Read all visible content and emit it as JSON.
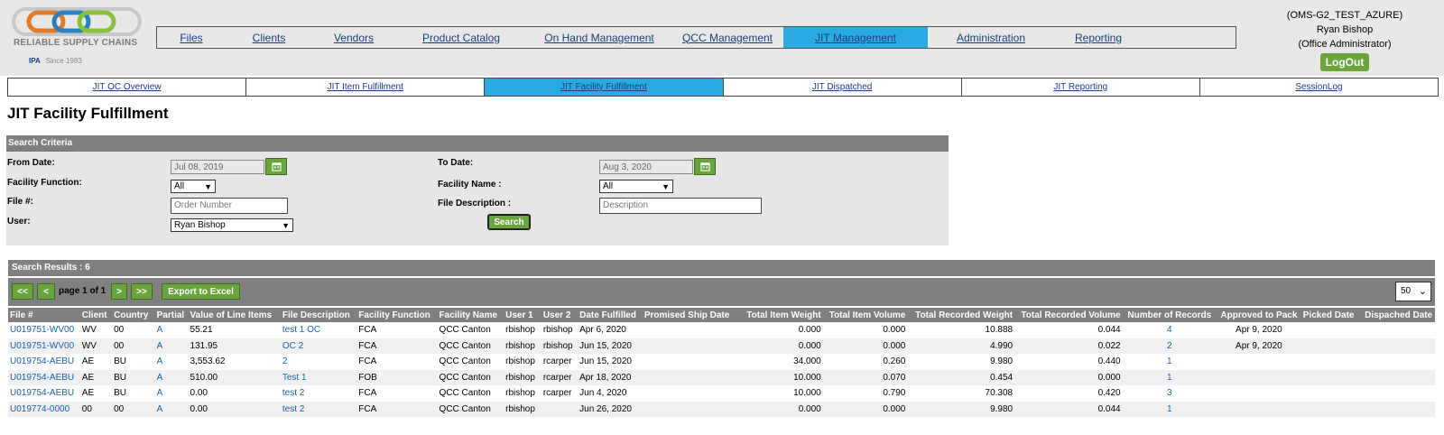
{
  "logo": {
    "brand": "RELIABLE SUPPLY CHAINS",
    "powered_by": "IPA",
    "since": "Since 1983",
    "ring_colors": [
      "#e07b2a",
      "#2a7fc1",
      "#8cbf3f",
      "#c0c0c0"
    ]
  },
  "main_nav": [
    {
      "label": "Files",
      "active": false
    },
    {
      "label": "Clients",
      "active": false
    },
    {
      "label": "Vendors",
      "active": false
    },
    {
      "label": "Product Catalog",
      "active": false
    },
    {
      "label": "On Hand Management",
      "active": false
    },
    {
      "label": "QCC Management",
      "active": false
    },
    {
      "label": "JIT Management",
      "active": true
    },
    {
      "label": "Administration",
      "active": false
    },
    {
      "label": "Reporting",
      "active": false
    }
  ],
  "user": {
    "environment": "(OMS-G2_TEST_AZURE)",
    "name": "Ryan Bishop",
    "role": "(Office Administrator)",
    "logout_label": "LogOut"
  },
  "sub_nav": [
    {
      "label": "JIT OC Overview",
      "active": false
    },
    {
      "label": "JIT Item Fulfillment",
      "active": false
    },
    {
      "label": "JIT Facility Fulfillment",
      "active": true
    },
    {
      "label": "JIT Dispatched",
      "active": false
    },
    {
      "label": "JIT Reporting",
      "active": false
    },
    {
      "label": "SessionLog",
      "active": false
    }
  ],
  "page_title": "JIT Facility Fulfillment",
  "search": {
    "header": "Search Criteria",
    "from_date_label": "From Date:",
    "from_date_value": "Jul 08, 2019",
    "to_date_label": "To Date:",
    "to_date_value": "Aug 3, 2020",
    "facility_function_label": "Facility Function:",
    "facility_function_value": "All",
    "facility_name_label": "Facility Name :",
    "facility_name_value": "All",
    "file_no_label": "File #:",
    "file_no_placeholder": "Order Number",
    "file_desc_label": "File Description :",
    "file_desc_placeholder": "Description",
    "user_label": "User:",
    "user_value": "Ryan Bishop",
    "search_button": "Search"
  },
  "results": {
    "header": "Search Results : 6",
    "first": "<<",
    "prev": "<",
    "page_text": "page 1 of 1",
    "next": ">",
    "last": ">>",
    "export": "Export to Excel",
    "page_size": "50",
    "columns": [
      "File #",
      "Client",
      "Country",
      "Partial",
      "Value of Line Items",
      "File Description",
      "Facility Function",
      "Facility Name",
      "User 1",
      "User 2",
      "Date Fulfilled",
      "Promised Ship Date",
      "Total Item Weight",
      "Total Item Volume",
      "Total Recorded Weight",
      "Total Recorded Volume",
      "Number of Records",
      "Approved to Pack",
      "Picked Date",
      "Dispached Date"
    ],
    "rows": [
      [
        "U019751-WV00",
        "WV",
        "00",
        "A",
        "55.21",
        "test 1 OC",
        "FCA",
        "QCC Canton",
        "rbishop",
        "rbishop",
        "Apr 6, 2020",
        "",
        "0.000",
        "0.000",
        "10.888",
        "0.044",
        "4",
        "Apr 9, 2020",
        "",
        ""
      ],
      [
        "U019751-WV00",
        "WV",
        "00",
        "A",
        "131.95",
        "OC 2",
        "FCA",
        "QCC Canton",
        "rbishop",
        "rbishop",
        "Jun 15, 2020",
        "",
        "0.000",
        "0.000",
        "4.990",
        "0.022",
        "2",
        "Apr 9, 2020",
        "",
        ""
      ],
      [
        "U019754-AEBU",
        "AE",
        "BU",
        "A",
        "3,553.62",
        "2",
        "FCA",
        "QCC Canton",
        "rbishop",
        "rcarper",
        "Jun 15, 2020",
        "",
        "34.000",
        "0.260",
        "9.980",
        "0.440",
        "1",
        "",
        "",
        ""
      ],
      [
        "U019754-AEBU",
        "AE",
        "BU",
        "A",
        "510.00",
        "Test 1",
        "FOB",
        "QCC Canton",
        "rbishop",
        "rcarper",
        "Apr 18, 2020",
        "",
        "10.000",
        "0.070",
        "0.454",
        "0.000",
        "1",
        "",
        "",
        ""
      ],
      [
        "U019754-AEBU",
        "AE",
        "BU",
        "A",
        "0.00",
        "test 2",
        "FCA",
        "QCC Canton",
        "rbishop",
        "rcarper",
        "Jun 4, 2020",
        "",
        "10.000",
        "0.790",
        "70.308",
        "0.420",
        "3",
        "",
        "",
        ""
      ],
      [
        "U019774-0000",
        "00",
        "00",
        "A",
        "0.00",
        "test 2",
        "FCA",
        "QCC Canton",
        "rbishop",
        "",
        "Jun 26, 2020",
        "",
        "0.000",
        "0.000",
        "9.980",
        "0.044",
        "1",
        "",
        "",
        ""
      ]
    ]
  }
}
